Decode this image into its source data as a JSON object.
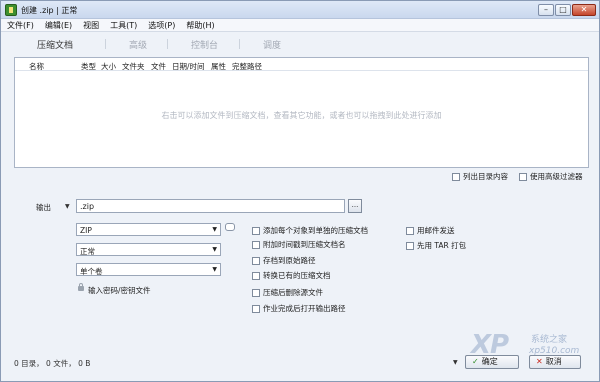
{
  "window": {
    "title": "创建 .zip | 正常",
    "controls": {
      "minimize": "–",
      "maximize": "□",
      "close": "✕"
    }
  },
  "menu": [
    "文件(F)",
    "编辑(E)",
    "视图",
    "工具(T)",
    "选项(P)",
    "帮助(H)"
  ],
  "tabs": [
    "压缩文档",
    "高级",
    "控制台",
    "调度"
  ],
  "filelist": {
    "columns": [
      "名称",
      "类型",
      "大小",
      "文件夹",
      "文件",
      "日期/时间",
      "属性",
      "完整路径"
    ],
    "empty_hint": "右击可以添加文件到压缩文档，查看其它功能，或者也可以拖拽到此处进行添加"
  },
  "list_options": {
    "show_dir_contents": "列出目录内容",
    "use_advanced_filter": "使用高级过滤器"
  },
  "output": {
    "label": "输出",
    "value": ".zip",
    "browse": "..."
  },
  "selects": {
    "format": "ZIP",
    "compression": "正常",
    "split": "单个卷"
  },
  "password_label": "输入密码/密钥文件",
  "options_left": [
    "添加每个对象到单独的压缩文档",
    "附加时间戳到压缩文档名",
    "存档到原始路径",
    "转换已有的压缩文档",
    "压缩后删除源文件",
    "作业完成后打开输出路径"
  ],
  "options_right": [
    "用邮件发送",
    "先用 TAR 打包"
  ],
  "status": "0 目录， 0 文件， 0 B",
  "buttons": {
    "ok": "确定",
    "cancel": "取消"
  },
  "watermark": {
    "logo": "XP",
    "cn": "系统之家",
    "url": "xp510.com"
  }
}
